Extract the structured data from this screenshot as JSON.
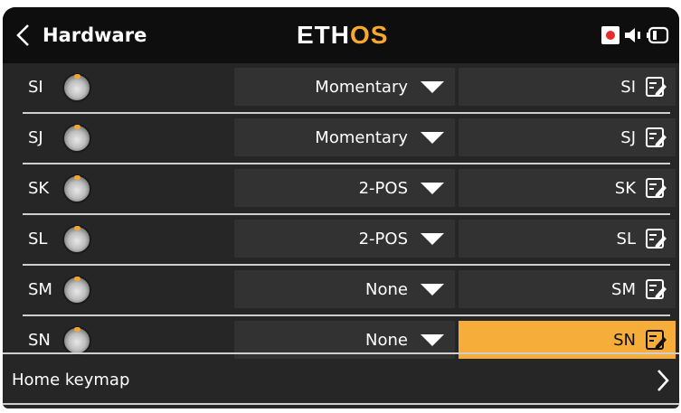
{
  "header": {
    "title": "Hardware",
    "logo_part1": "ETH",
    "logo_part2": "OS",
    "icons": [
      "back-chevron-icon",
      "record-icon",
      "speaker-icon",
      "battery-icon"
    ]
  },
  "switches": [
    {
      "label": "SI",
      "type": "Momentary",
      "name": "SI"
    },
    {
      "label": "SJ",
      "type": "Momentary",
      "name": "SJ"
    },
    {
      "label": "SK",
      "type": "2-POS",
      "name": "SK"
    },
    {
      "label": "SL",
      "type": "2-POS",
      "name": "SL"
    },
    {
      "label": "SM",
      "type": "None",
      "name": "SM"
    },
    {
      "label": "SN",
      "type": "None",
      "name": "SN",
      "selected": true
    }
  ],
  "home_keymap": {
    "label": "Home keymap"
  },
  "colors": {
    "accent": "#f6ad3a",
    "background": "#262626",
    "field": "#323232",
    "record": "#e82b2b"
  }
}
